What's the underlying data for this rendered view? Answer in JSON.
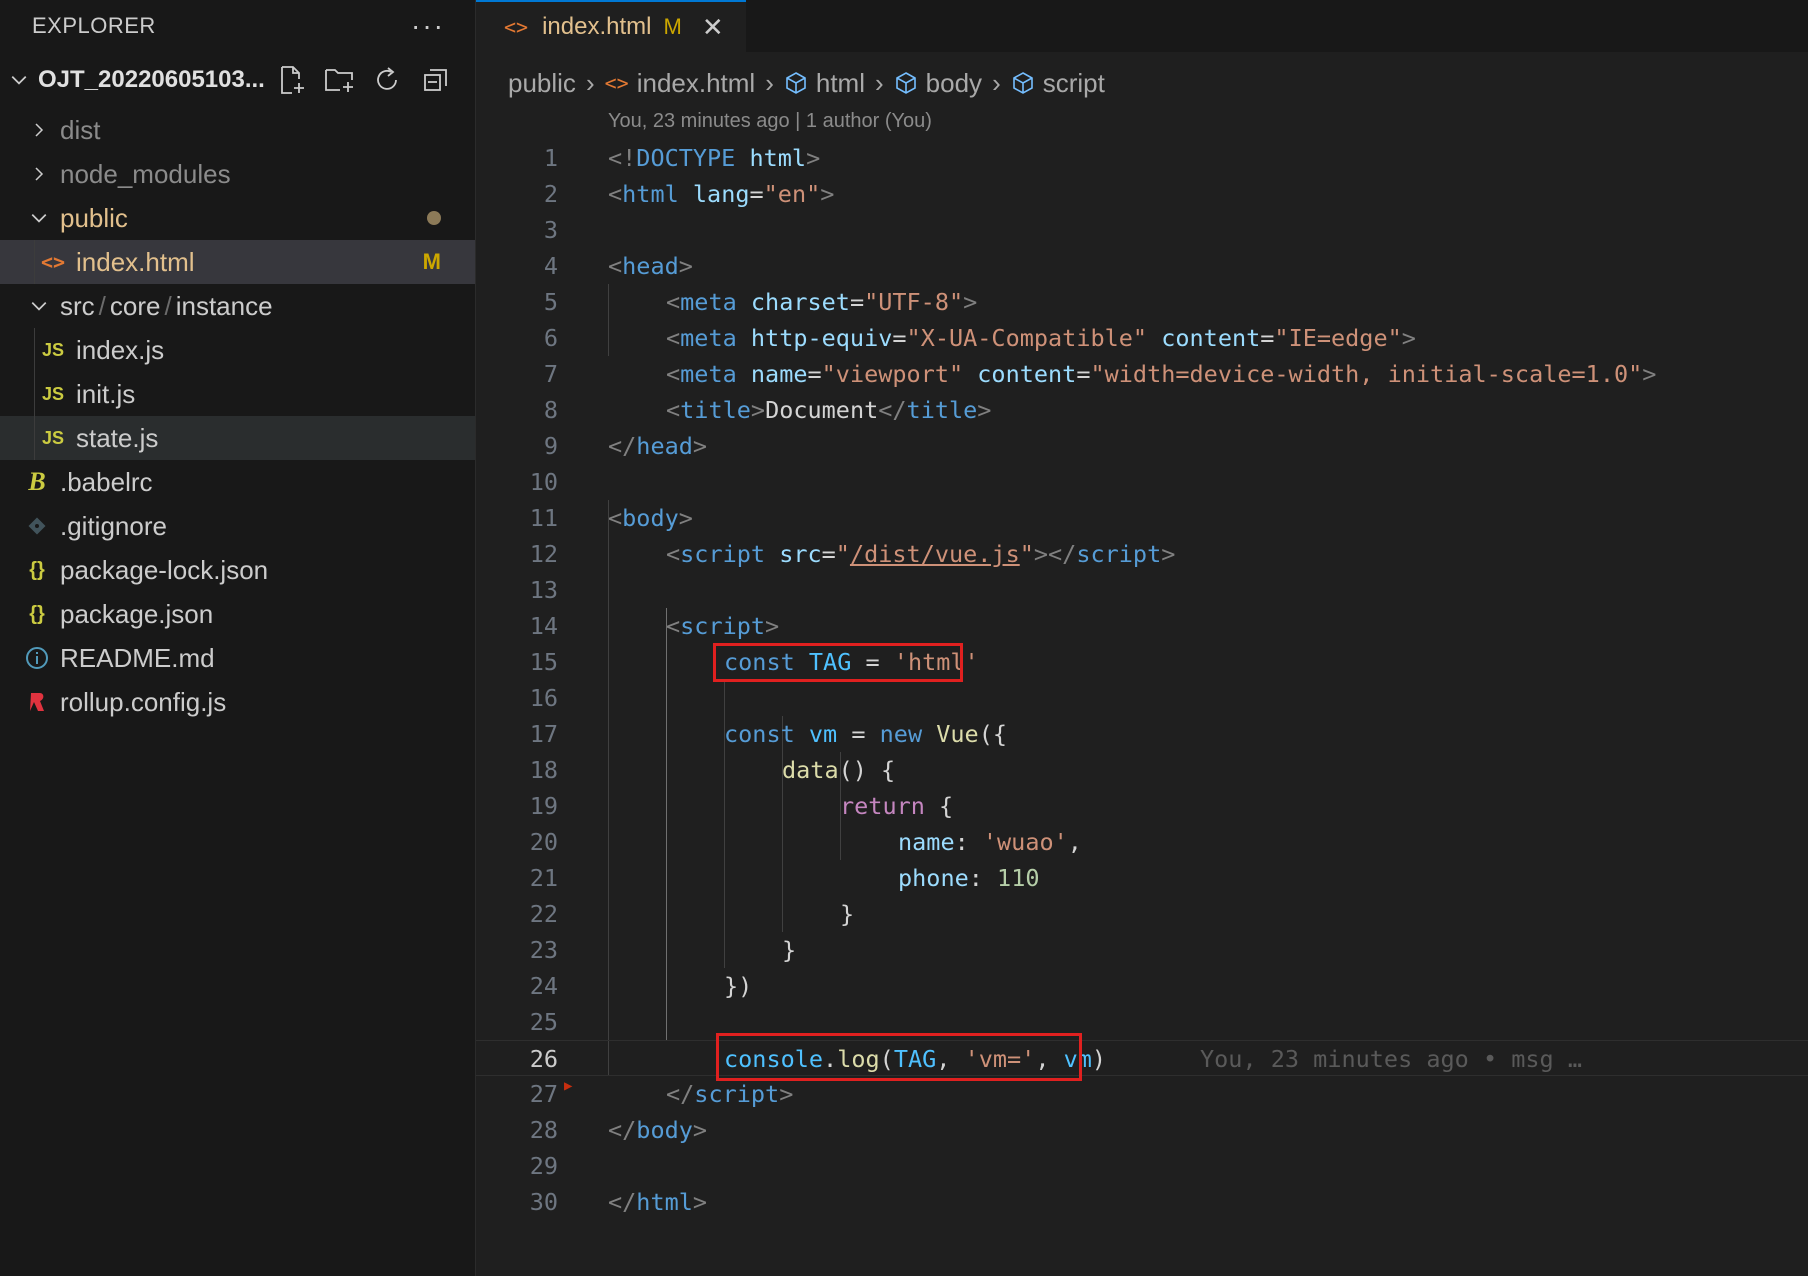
{
  "explorer": {
    "title": "EXPLORER",
    "more": "···",
    "project_name": "OJT_20220605103...",
    "items": [
      {
        "label": "dist"
      },
      {
        "label": "node_modules"
      },
      {
        "label": "public"
      },
      {
        "label": "index.html",
        "badge": "M"
      },
      {
        "label": "src",
        "label2": "core",
        "label3": "instance",
        "sep": "/"
      },
      {
        "label": "index.js",
        "icon": "JS"
      },
      {
        "label": "init.js",
        "icon": "JS"
      },
      {
        "label": "state.js",
        "icon": "JS"
      },
      {
        "label": ".babelrc"
      },
      {
        "label": ".gitignore"
      },
      {
        "label": "package-lock.json",
        "icon": "{}"
      },
      {
        "label": "package.json",
        "icon": "{}"
      },
      {
        "label": "README.md"
      },
      {
        "label": "rollup.config.js"
      }
    ]
  },
  "tab": {
    "icon": "<>",
    "label": "index.html",
    "modified": "M",
    "close": "✕"
  },
  "breadcrumb": {
    "items": [
      "public",
      "index.html",
      "html",
      "body",
      "script"
    ],
    "sep": "›"
  },
  "blame_header": "You, 23 minutes ago | 1 author (You)",
  "inline_blame": "You, 23 minutes ago • msg …",
  "line_numbers": [
    "1",
    "2",
    "3",
    "4",
    "5",
    "6",
    "7",
    "8",
    "9",
    "10",
    "11",
    "12",
    "13",
    "14",
    "15",
    "16",
    "17",
    "18",
    "19",
    "20",
    "21",
    "22",
    "23",
    "24",
    "25",
    "26",
    "27",
    "28",
    "29",
    "30"
  ],
  "code": {
    "l1": [
      "<!",
      "DOCTYPE",
      " html",
      ">"
    ],
    "l2": [
      "<",
      "html",
      " lang",
      "=",
      "\"en\"",
      ">"
    ],
    "l4": [
      "<",
      "head",
      ">"
    ],
    "l5": [
      "<",
      "meta",
      " charset",
      "=",
      "\"UTF-8\"",
      ">"
    ],
    "l6": [
      "<",
      "meta",
      " http-equiv",
      "=",
      "\"X-UA-Compatible\"",
      " content",
      "=",
      "\"IE=edge\"",
      ">"
    ],
    "l7": [
      "<",
      "meta",
      " name",
      "=",
      "\"viewport\"",
      " content",
      "=",
      "\"width=device-width, initial-scale=1.0\"",
      ">"
    ],
    "l8": [
      "<",
      "title",
      ">",
      "Document",
      "</",
      "title",
      ">"
    ],
    "l9": [
      "</",
      "head",
      ">"
    ],
    "l11": [
      "<",
      "body",
      ">"
    ],
    "l12": [
      "<",
      "script",
      " src",
      "=",
      "\"",
      "/dist/vue.js",
      "\"",
      "></",
      "script",
      ">"
    ],
    "l14": [
      "<",
      "script",
      ">"
    ],
    "l15": [
      "const",
      " TAG",
      " = ",
      "'html'"
    ],
    "l17": [
      "const",
      " vm",
      " = ",
      "new",
      " Vue",
      "({"
    ],
    "l18": [
      "data",
      "() {"
    ],
    "l19": [
      "return",
      " {"
    ],
    "l20": [
      "name",
      ": ",
      "'wuao'",
      ","
    ],
    "l21": [
      "phone",
      ": ",
      "110"
    ],
    "l22": [
      "}"
    ],
    "l23": [
      "}"
    ],
    "l24": [
      "})"
    ],
    "l26": [
      "console",
      ".",
      "log",
      "(",
      "TAG",
      ", ",
      "'vm='",
      ", ",
      "vm",
      ")"
    ],
    "l27": [
      "</",
      "script",
      ">"
    ],
    "l28": [
      "</",
      "body",
      ">"
    ],
    "l30": [
      "</",
      "html",
      ">"
    ]
  },
  "colors": {
    "highlight_box": "#e0201f",
    "modified_badge": "#cca700"
  }
}
